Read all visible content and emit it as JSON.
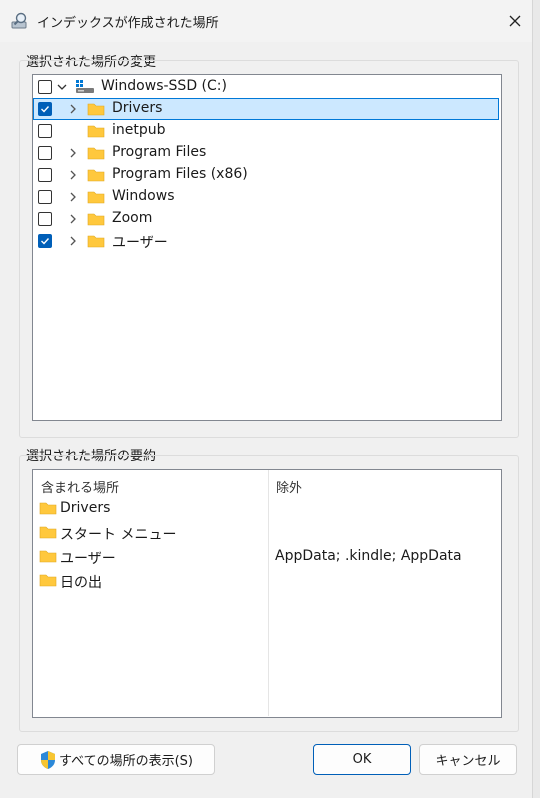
{
  "window": {
    "title": "インデックスが作成された場所"
  },
  "modify_group": {
    "label": "選択された場所の変更",
    "tree": {
      "drive": {
        "label": "Windows-SSD (C:)",
        "checked": false,
        "expanded": true
      },
      "items": [
        {
          "label": "Drivers",
          "checked": true,
          "has_children": true,
          "selected": true
        },
        {
          "label": "inetpub",
          "checked": false,
          "has_children": false,
          "selected": false
        },
        {
          "label": "Program Files",
          "checked": false,
          "has_children": true,
          "selected": false
        },
        {
          "label": "Program Files (x86)",
          "checked": false,
          "has_children": true,
          "selected": false
        },
        {
          "label": "Windows",
          "checked": false,
          "has_children": true,
          "selected": false
        },
        {
          "label": "Zoom",
          "checked": false,
          "has_children": true,
          "selected": false
        },
        {
          "label": "ユーザー",
          "checked": true,
          "has_children": true,
          "selected": false
        }
      ]
    }
  },
  "summary_group": {
    "label": "選択された場所の要約",
    "columns": {
      "included": "含まれる場所",
      "excluded": "除外"
    },
    "rows": [
      {
        "included": "Drivers",
        "excluded": ""
      },
      {
        "included": "スタート メニュー",
        "excluded": ""
      },
      {
        "included": "ユーザー",
        "excluded": "AppData; .kindle; AppData"
      },
      {
        "included": "日の出",
        "excluded": ""
      }
    ]
  },
  "buttons": {
    "show_all": "すべての場所の表示(S)",
    "ok": "OK",
    "cancel": "キャンセル"
  },
  "colors": {
    "accent": "#005fb8",
    "selection": "#cce8ff",
    "folder": "#ffc83d"
  }
}
